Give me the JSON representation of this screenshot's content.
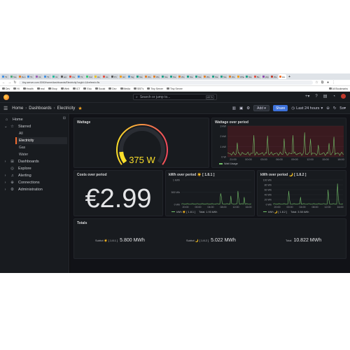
{
  "browser": {
    "tabs": [
      {
        "label": "Tit",
        "color": "#3a8ee6"
      },
      {
        "label": "Ste",
        "color": "#4a7"
      },
      {
        "label": "Den",
        "color": "#e67e22"
      },
      {
        "label": "Tit",
        "color": "#3a8ee6"
      },
      {
        "label": "Int",
        "color": "#9b59b6"
      },
      {
        "label": "Tit",
        "color": "#3a8ee6"
      },
      {
        "label": "Ini",
        "color": "#1abc9c"
      },
      {
        "label": "apt",
        "color": "#555"
      },
      {
        "label": "Ca",
        "color": "#e74c3c"
      },
      {
        "label": "Tit",
        "color": "#3a8ee6"
      },
      {
        "label": "Cal",
        "color": "#2ecc71"
      },
      {
        "label": "Ho",
        "color": "#f1c40f"
      },
      {
        "label": "As",
        "color": "#e74c3c"
      },
      {
        "label": "Pri",
        "color": "#555"
      },
      {
        "label": "Gri",
        "color": "#f39c12"
      },
      {
        "label": "Sig",
        "color": "#3498db"
      },
      {
        "label": "Ste",
        "color": "#16a085"
      },
      {
        "label": "Wo",
        "color": "#e67e22"
      },
      {
        "label": "Wo",
        "color": "#e67e22"
      },
      {
        "label": "Ste",
        "color": "#16a085"
      },
      {
        "label": "Ste",
        "color": "#16a085"
      },
      {
        "label": "Wo",
        "color": "#e67e22"
      },
      {
        "label": "Ste",
        "color": "#16a085"
      },
      {
        "label": "Ste",
        "color": "#16a085"
      },
      {
        "label": "Wo",
        "color": "#e67e22"
      },
      {
        "label": "Ste",
        "color": "#16a085"
      },
      {
        "label": "Ste",
        "color": "#16a085"
      },
      {
        "label": "Wo",
        "color": "#e67e22"
      },
      {
        "label": "Whe",
        "color": "#f39c12"
      },
      {
        "label": "Ste",
        "color": "#16a085"
      },
      {
        "label": "Be",
        "color": "#e74c3c"
      },
      {
        "label": "php",
        "color": "#8e44ad"
      },
      {
        "label": "We",
        "color": "#c0392b"
      },
      {
        "label": "Ele",
        "color": "#f46a1f"
      }
    ],
    "url": "tiny-server.com:3000/home/dashboards/Electricity?orgId=1&refresh=5s",
    "bookmarks": [
      "Dev",
      "Hi",
      "Health",
      "real",
      "Shop",
      "Web",
      "ICT",
      "Edu",
      "Social",
      "Dev",
      "Media",
      "SBT's",
      "Tiny Server",
      "Tiny Server"
    ],
    "all_bookmarks": "All Bookmarks"
  },
  "topbar": {
    "search_placeholder": "Search or jump to...",
    "search_shortcut": "ctrl+k"
  },
  "breadcrumb": {
    "home": "Home",
    "dashboards": "Dashboards",
    "current": "Electricity"
  },
  "toolbar": {
    "add_label": "Add",
    "share_label": "Share",
    "time_range": "Last 24 hours",
    "refresh_interval": "5s"
  },
  "sidebar": {
    "home": "Home",
    "starred": "Starred",
    "starred_items": [
      "All",
      "Electricity",
      "Gas",
      "Water"
    ],
    "dashboards": "Dashboards",
    "explore": "Explore",
    "alerting": "Alerting",
    "connections": "Connections",
    "administration": "Administration"
  },
  "panels": {
    "wattage": {
      "title": "Wattage",
      "value": "375 W",
      "gauge_fraction": 0.12
    },
    "wattage_over_period": {
      "title": "Wattage over period",
      "legend": "Watt Usage",
      "y_ticks": [
        "3 kW",
        "2 kW",
        "1 kW",
        "0 W"
      ],
      "x_ticks": [
        "21:00",
        "00:00",
        "03:00",
        "06:00",
        "09:00",
        "12:00",
        "15:00",
        "18:00"
      ]
    },
    "costs": {
      "title": "Costs over period",
      "value": "€2.99"
    },
    "kwh_181": {
      "title": "kWh over period ☀️ [ 1.8.1 ]",
      "y_ticks": [
        "1 kWh",
        "500 Wh",
        "0 Wh"
      ],
      "x_ticks": [
        "20:00",
        "00:00",
        "04:00",
        "08:00",
        "12:00",
        "16:00"
      ],
      "legend": "kWh ☀️ [ 1.8.1 ]",
      "total": "Total: 1.93 kWh"
    },
    "kwh_182": {
      "title": "kWh over period 🌙 [ 1.8.2 ]",
      "y_ticks": [
        "100 Wh",
        "80 Wh",
        "60 Wh",
        "40 Wh",
        "20 Wh",
        "0 Wh"
      ],
      "x_ticks": [
        "20:00",
        "00:00",
        "04:00",
        "08:00",
        "12:00",
        "16:00"
      ],
      "legend": "kWh 🌙 [ 1.8.2 ]",
      "total": "Total: 3.58 kWh"
    },
    "totals": {
      "title": "Totals",
      "items": [
        {
          "label": "Subtot ☀️ [ 1.8.1 ]",
          "value": "5.800 MWh"
        },
        {
          "label": "Subtot 🌙 [ 1.8.2 ]",
          "value": "5.022 MWh"
        },
        {
          "label": "Total",
          "value": "10.822 MWh"
        }
      ]
    }
  },
  "colors": {
    "accent": "#f26b2f",
    "series": "#73bf69",
    "gauge_yellow": "#fade2a",
    "gauge_red": "#f2495c",
    "threshold_red": "#3a1a1f"
  }
}
